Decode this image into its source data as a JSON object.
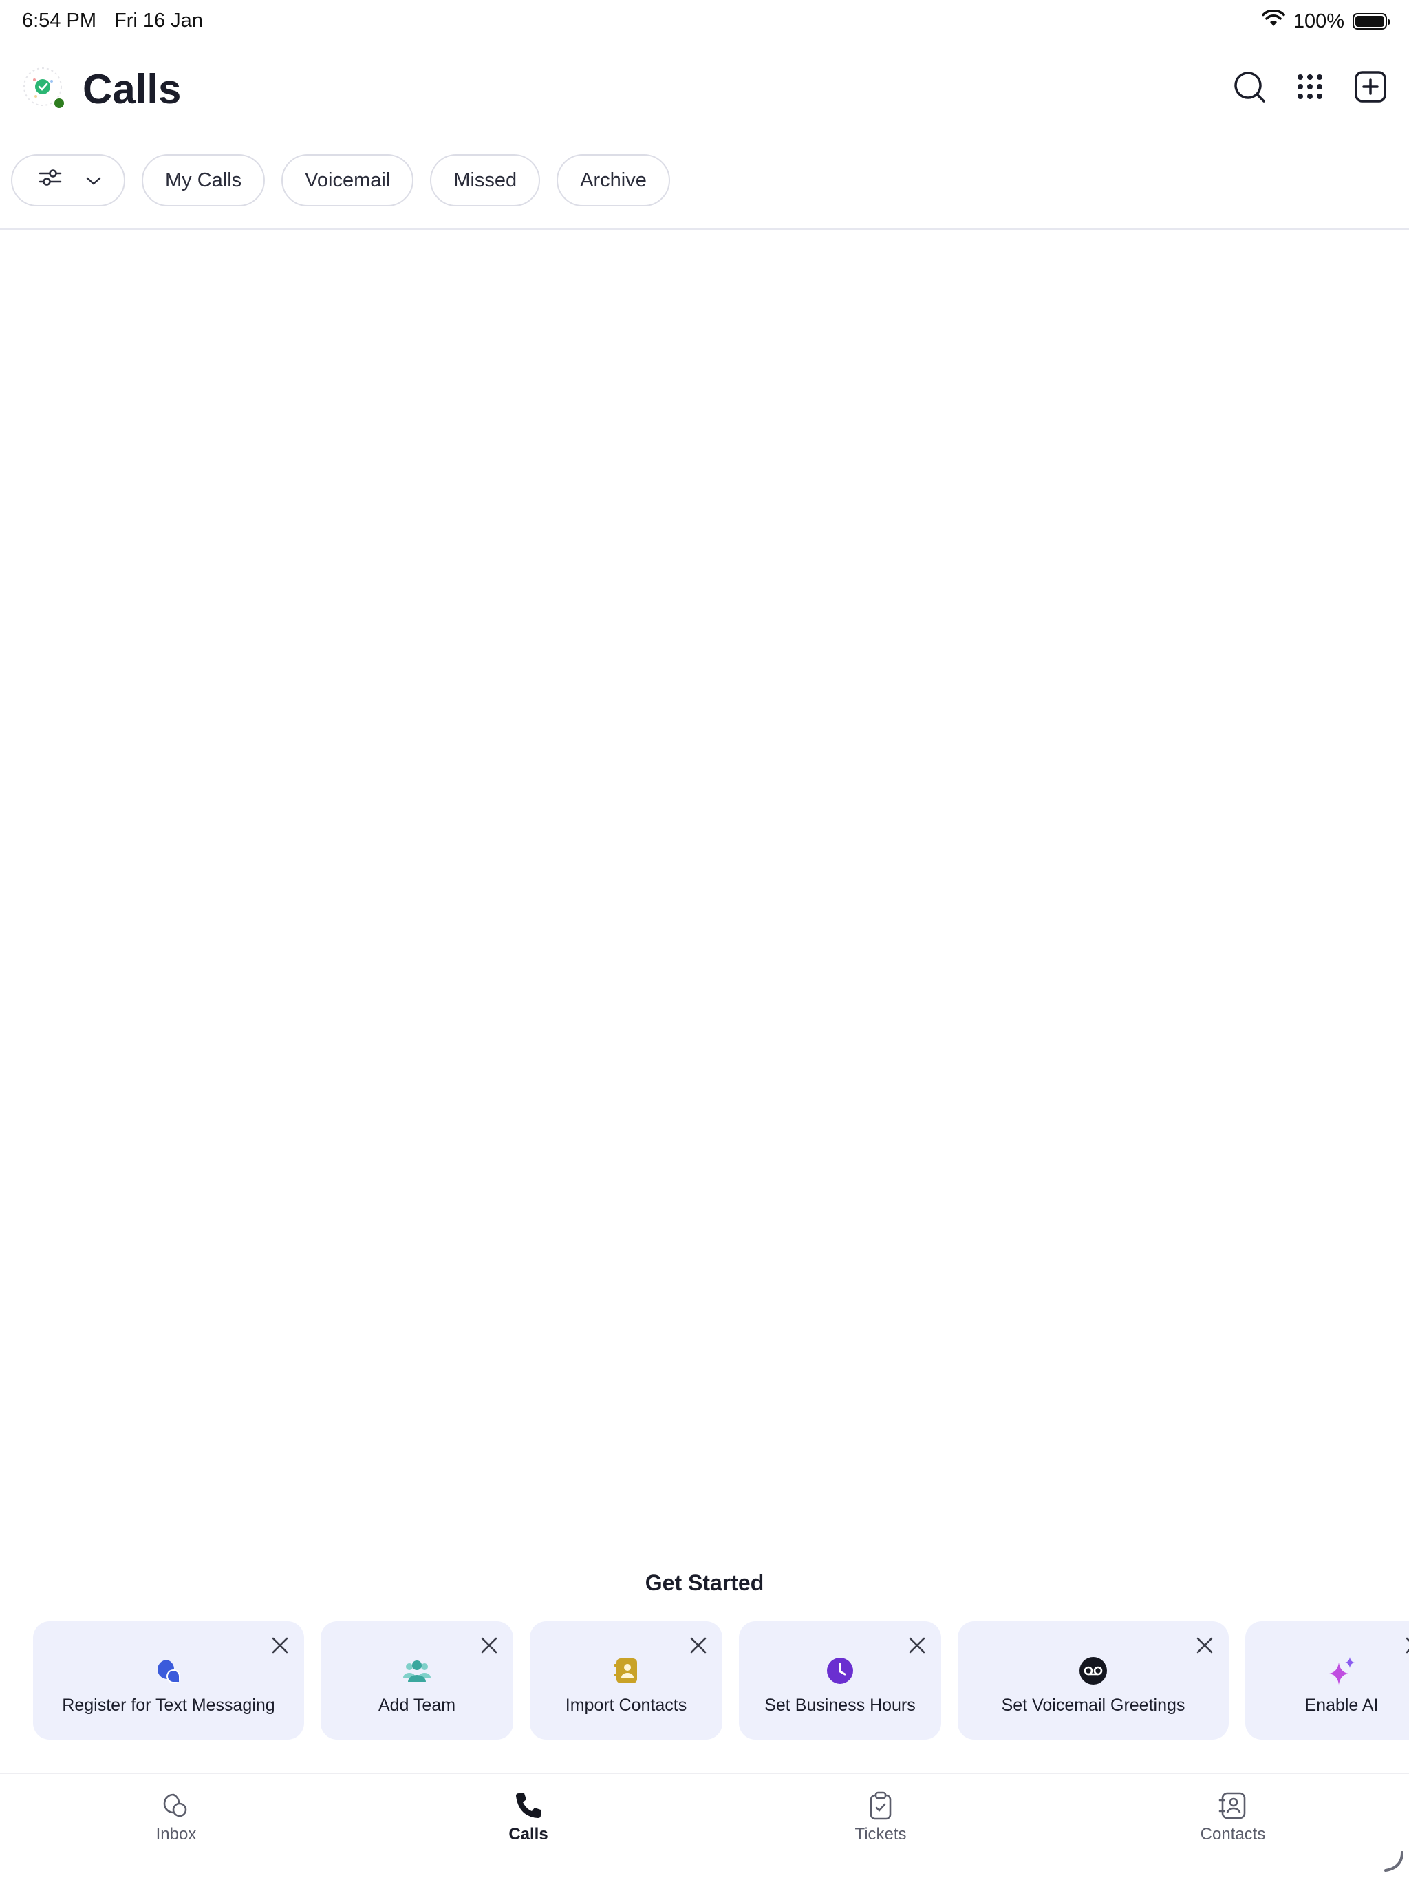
{
  "status_bar": {
    "time": "6:54 PM",
    "date": "Fri 16 Jan",
    "battery": "100%",
    "icons": [
      "wifi-icon",
      "battery-icon"
    ]
  },
  "header": {
    "title": "Calls",
    "actions": [
      "search-icon",
      "dialpad-icon",
      "compose-icon"
    ]
  },
  "filters": {
    "chips": [
      "My Calls",
      "Voicemail",
      "Missed",
      "Archive"
    ]
  },
  "get_started": {
    "title": "Get Started",
    "cards": [
      {
        "label": "Register for Text Messaging",
        "icon": "text-messaging-icon"
      },
      {
        "label": "Add Team",
        "icon": "team-icon"
      },
      {
        "label": "Import Contacts",
        "icon": "contacts-book-icon"
      },
      {
        "label": "Set Business Hours",
        "icon": "clock-icon"
      },
      {
        "label": "Set Voicemail Greetings",
        "icon": "voicemail-icon"
      },
      {
        "label": "Enable AI",
        "icon": "sparkle-icon"
      }
    ]
  },
  "tabbar": {
    "tabs": [
      {
        "label": "Inbox",
        "icon": "inbox-icon"
      },
      {
        "label": "Calls",
        "icon": "phone-icon",
        "active": true
      },
      {
        "label": "Tickets",
        "icon": "clipboard-icon"
      },
      {
        "label": "Contacts",
        "icon": "contact-card-icon"
      }
    ]
  },
  "colors": {
    "card_bg": "#eef0fc",
    "text_messaging": "#3b5bdb",
    "team": "#4fb8b0",
    "contacts": "#c9a227",
    "clock": "#6a2fd0",
    "voicemail": "#14161f",
    "ai": "#c04ee0"
  }
}
